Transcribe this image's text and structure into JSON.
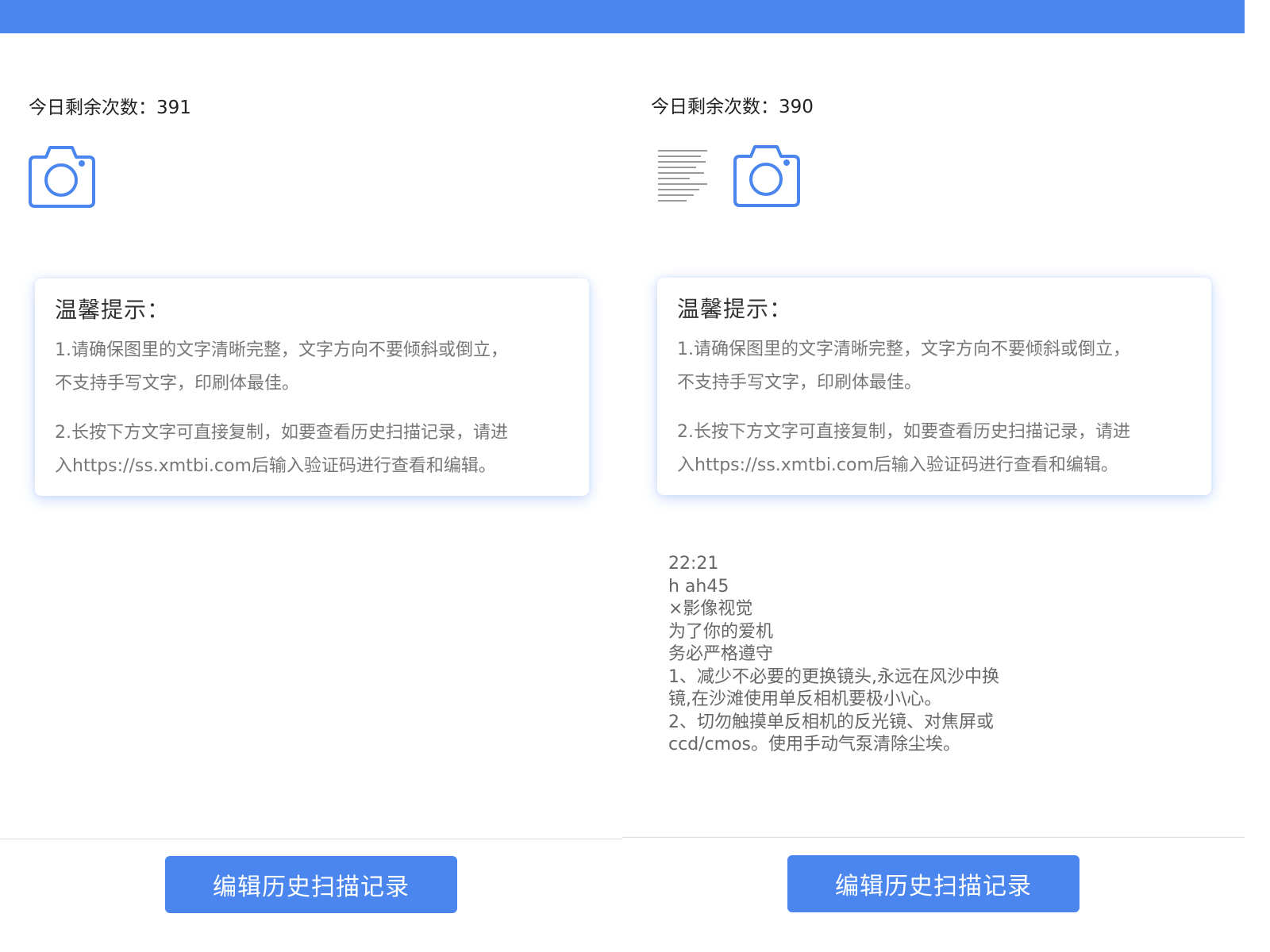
{
  "colors": {
    "accent": "#4a86ee",
    "text": "#333333",
    "muted": "#777777"
  },
  "icons": {
    "camera": "camera-icon"
  },
  "left": {
    "remaining_label": "今日剩余次数：391",
    "tips": {
      "title": "温馨提示：",
      "line1a": "1.请确保图里的文字清晰完整，文字方向不要倾斜或倒立，",
      "line1b": "不支持手写文字，印刷体最佳。",
      "line2a": "2.长按下方文字可直接复制，如要查看历史扫描记录，请进",
      "line2b": "入https://ss.xmtbi.com后输入验证码进行查看和编辑。"
    },
    "button_label": "编辑历史扫描记录"
  },
  "right": {
    "remaining_label": "今日剩余次数：390",
    "tips": {
      "title": "温馨提示：",
      "line1a": "1.请确保图里的文字清晰完整，文字方向不要倾斜或倒立，",
      "line1b": "不支持手写文字，印刷体最佳。",
      "line2a": "2.长按下方文字可直接复制，如要查看历史扫描记录，请进",
      "line2b": "入https://ss.xmtbi.com后输入验证码进行查看和编辑。"
    },
    "ocr_lines": [
      "22:21",
      "h ah45",
      "×影像视觉",
      "为了你的爱机",
      "务必严格遵守",
      "1、减少不必要的更换镜头,永远在风沙中换",
      "镜,在沙滩使用单反相机要极小\\心。",
      "2、切勿触摸单反相机的反光镜、对焦屏或",
      "ccd/cmos。使用手动气泵清除尘埃。"
    ],
    "button_label": "编辑历史扫描记录"
  }
}
